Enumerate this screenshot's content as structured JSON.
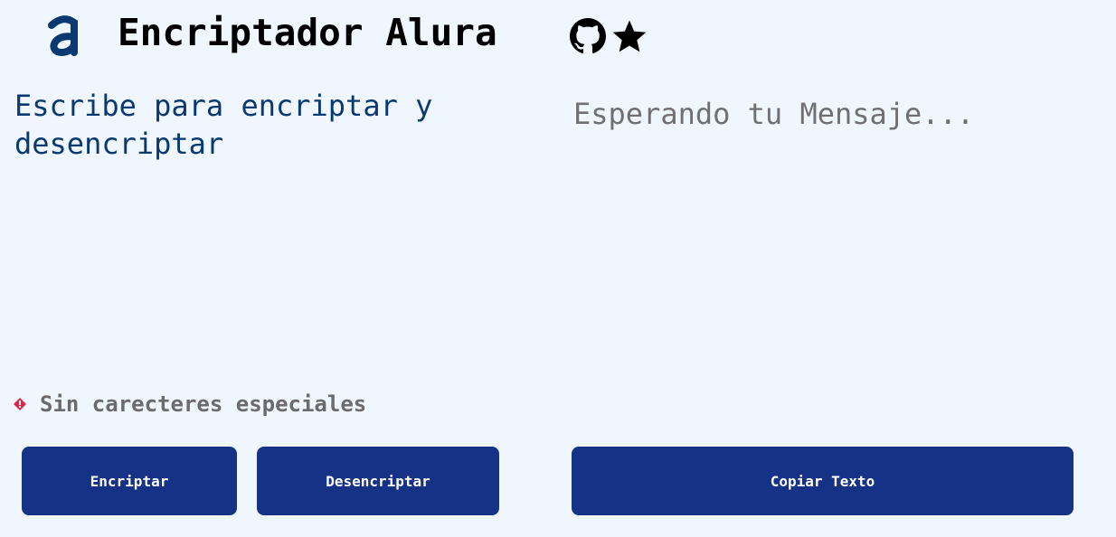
{
  "header": {
    "logo_icon": "alura-logo-icon",
    "title": "Encriptador Alura",
    "icons": [
      "github-icon",
      "star-icon"
    ]
  },
  "input": {
    "placeholder": "Escribe para encriptar y desencriptar",
    "value": ""
  },
  "output": {
    "placeholder": "Esperando tu Mensaje...",
    "value": ""
  },
  "warning": {
    "icon": "diamond-warning-icon",
    "text": "Sin carecteres especiales"
  },
  "buttons": {
    "encrypt_label": "Encriptar",
    "decrypt_label": "Desencriptar",
    "copy_label": "Copiar Texto"
  },
  "colors": {
    "background": "#eff6fd",
    "accent": "#153286",
    "input_text": "#0a3871",
    "muted_text": "#707070",
    "warning_icon": "#e0264a"
  }
}
